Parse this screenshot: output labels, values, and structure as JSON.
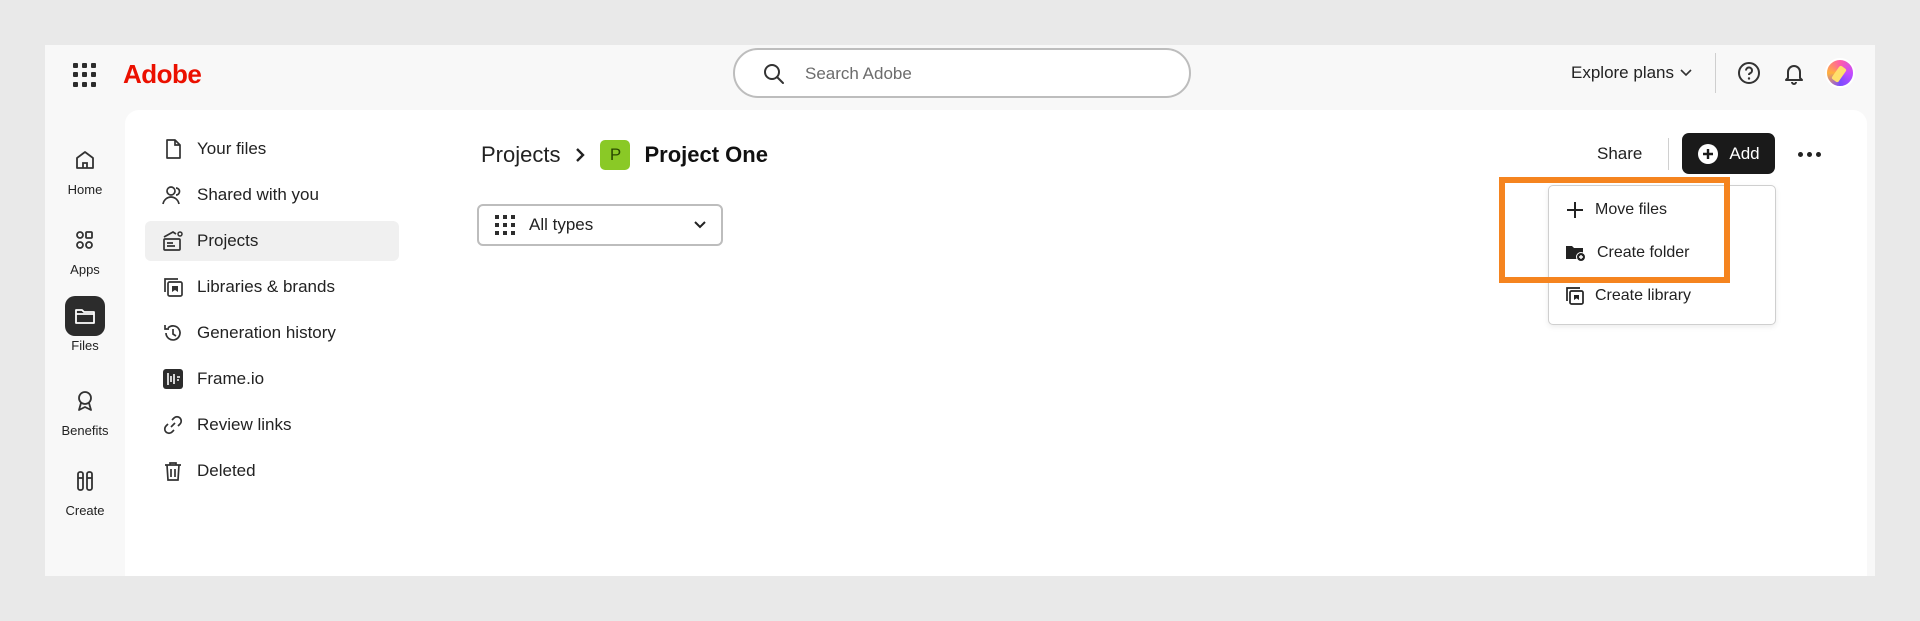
{
  "brand": {
    "logo_text": "Adobe",
    "logo_color": "#eb1000"
  },
  "search": {
    "placeholder": "Search Adobe"
  },
  "topbar": {
    "explore_label": "Explore plans",
    "help_icon": "help-icon",
    "bell_icon": "bell-icon"
  },
  "rail": {
    "items": [
      {
        "label": "Home",
        "icon": "home-icon"
      },
      {
        "label": "Apps",
        "icon": "apps-icon"
      },
      {
        "label": "Files",
        "icon": "folder-icon",
        "active": true
      },
      {
        "label": "Benefits",
        "icon": "ribbon-icon"
      },
      {
        "label": "Create",
        "icon": "create-icon"
      }
    ]
  },
  "nav": {
    "items": [
      {
        "label": "Your files",
        "icon": "file-icon"
      },
      {
        "label": "Shared with you",
        "icon": "shared-users-icon"
      },
      {
        "label": "Projects",
        "icon": "projects-icon",
        "active": true
      },
      {
        "label": "Libraries & brands",
        "icon": "library-icon"
      },
      {
        "label": "Generation history",
        "icon": "history-icon"
      },
      {
        "label": "Frame.io",
        "icon": "frameio-icon"
      },
      {
        "label": "Review links",
        "icon": "link-icon"
      },
      {
        "label": "Deleted",
        "icon": "trash-icon"
      }
    ]
  },
  "breadcrumb": {
    "parent": "Projects",
    "badge": "P",
    "current": "Project One",
    "badge_color": "#8ac926"
  },
  "filter": {
    "selected": "All types"
  },
  "actions": {
    "share_label": "Share",
    "add_label": "Add"
  },
  "add_menu": {
    "items": [
      {
        "label": "Move files",
        "icon": "move-icon"
      },
      {
        "label": "Create folder",
        "icon": "create-folder-icon"
      },
      {
        "label": "Create library",
        "icon": "create-library-icon"
      }
    ]
  },
  "colors": {
    "highlight": "#f5841f",
    "add_button": "#1a1a1a"
  }
}
